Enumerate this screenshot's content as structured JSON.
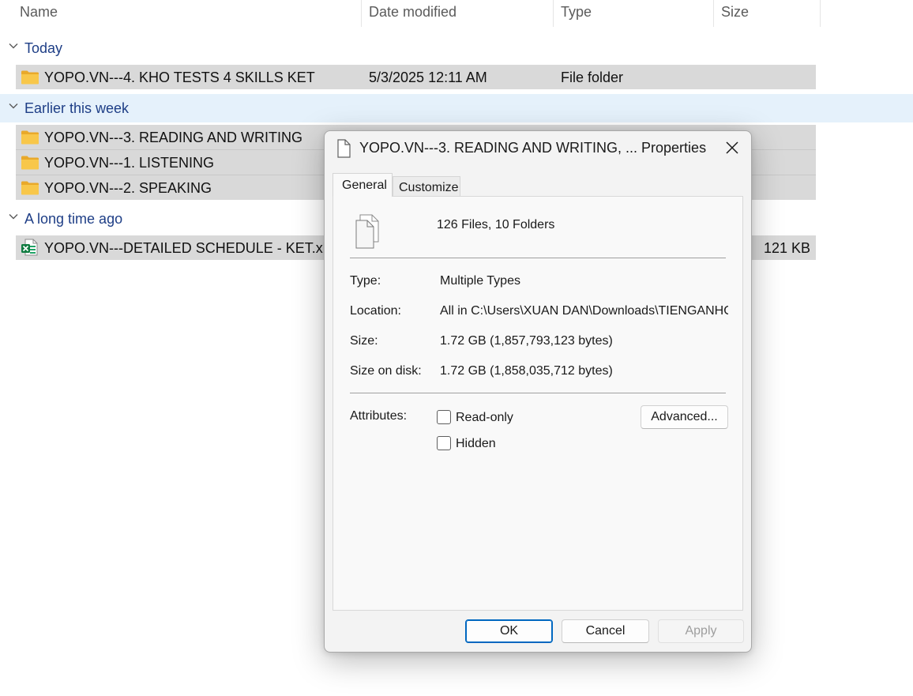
{
  "columns": {
    "name": "Name",
    "date_modified": "Date modified",
    "type": "Type",
    "size": "Size"
  },
  "groups": [
    {
      "label": "Today",
      "rows": [
        {
          "name": "YOPO.VN---4. KHO TESTS 4 SKILLS KET",
          "date": "5/3/2025 12:11 AM",
          "type": "File folder",
          "size": "",
          "icon": "folder-icon"
        }
      ]
    },
    {
      "label": "Earlier this week",
      "rows": [
        {
          "name": "YOPO.VN---3. READING AND WRITING",
          "date": "",
          "type": "",
          "size": "",
          "icon": "folder-icon"
        },
        {
          "name": "YOPO.VN---1. LISTENING",
          "date": "",
          "type": "",
          "size": "",
          "icon": "folder-icon"
        },
        {
          "name": "YOPO.VN---2. SPEAKING",
          "date": "",
          "type": "",
          "size": "",
          "icon": "folder-icon"
        }
      ]
    },
    {
      "label": "A long time ago",
      "rows": [
        {
          "name": "YOPO.VN---DETAILED SCHEDULE - KET.xlsx",
          "date": "",
          "type": "",
          "size": "121 KB",
          "icon": "excel-file-icon"
        }
      ]
    }
  ],
  "dialog": {
    "title": "YOPO.VN---3. READING AND WRITING, ... Properties",
    "tabs": [
      "General",
      "Customize"
    ],
    "summary": "126 Files, 10 Folders",
    "fields": {
      "type_label": "Type:",
      "type_value": "Multiple Types",
      "location_label": "Location:",
      "location_value": "All in C:\\Users\\XUAN DAN\\Downloads\\TIENGANHO",
      "size_label": "Size:",
      "size_value": "1.72 GB (1,857,793,123 bytes)",
      "size_on_disk_label": "Size on disk:",
      "size_on_disk_value": "1.72 GB (1,858,035,712 bytes)"
    },
    "attributes_label": "Attributes:",
    "readonly_label": "Read-only",
    "hidden_label": "Hidden",
    "advanced_label": "Advanced...",
    "ok_label": "OK",
    "cancel_label": "Cancel",
    "apply_label": "Apply"
  },
  "colors": {
    "group_text": "#1e3e86",
    "selection_row": "#d9d9d9",
    "hover_group": "#e5f1fb",
    "accent": "#0067c0",
    "folder": "#f8c74a"
  }
}
